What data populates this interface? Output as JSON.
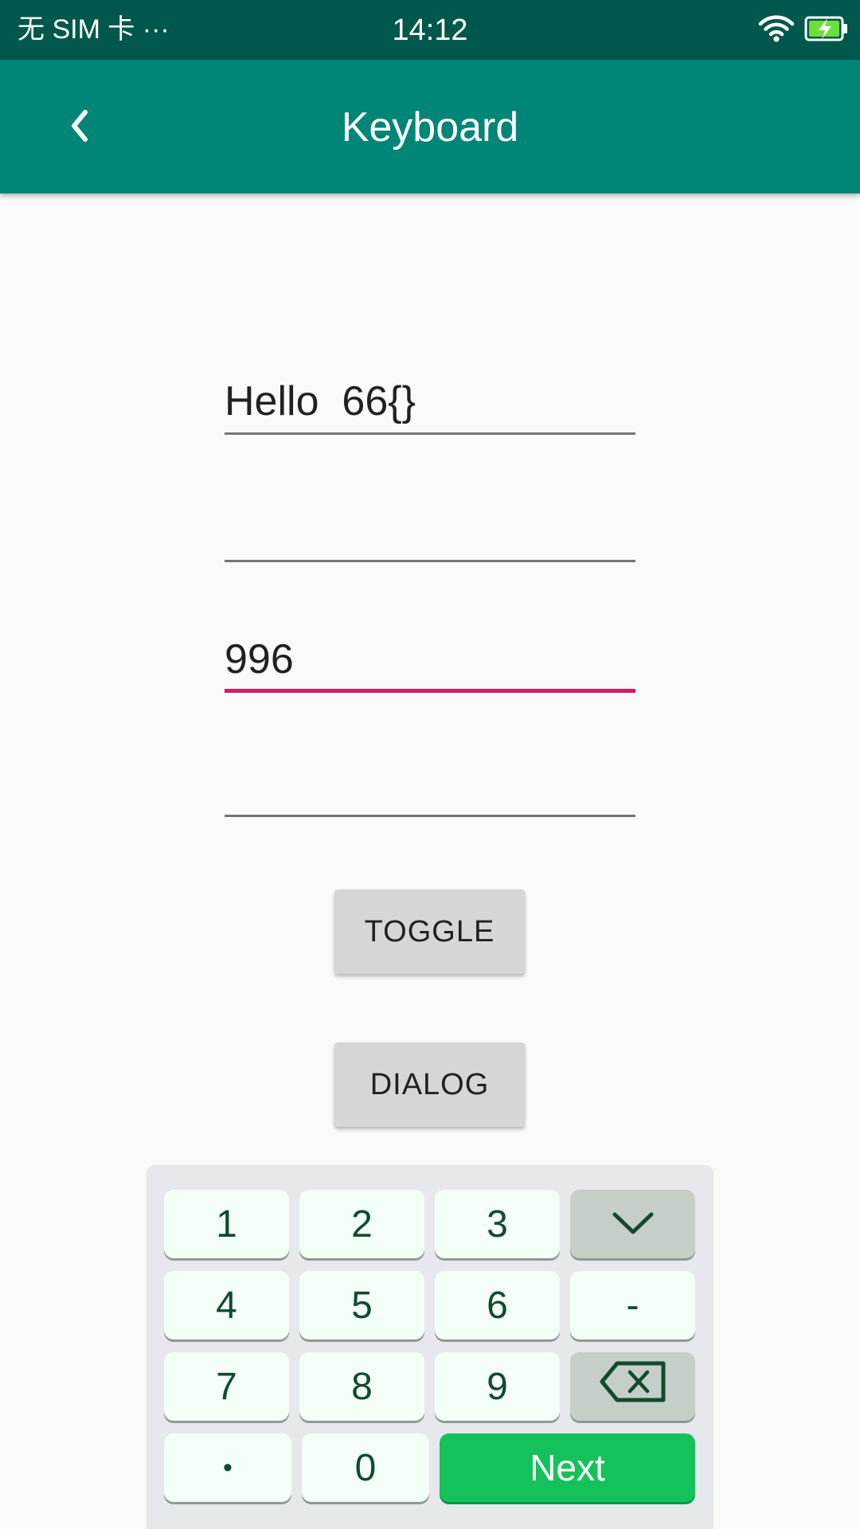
{
  "status_bar": {
    "carrier": "无 SIM 卡 ···",
    "time": "14:12",
    "wifi_icon": "wifi-icon",
    "battery_icon": "battery-charging-icon"
  },
  "app_bar": {
    "title": "Keyboard",
    "back_icon": "chevron-left-icon"
  },
  "fields": [
    {
      "value": "Hello  66{}",
      "focused": false
    },
    {
      "value": "",
      "focused": false
    },
    {
      "value": "996",
      "focused": true
    },
    {
      "value": "",
      "focused": false
    }
  ],
  "buttons": {
    "toggle_label": "TOGGLE",
    "dialog_label": "DIALOG"
  },
  "keyboard": {
    "keys": {
      "k1": "1",
      "k2": "2",
      "k3": "3",
      "k4": "4",
      "k5": "5",
      "k6": "6",
      "dash": "-",
      "k7": "7",
      "k8": "8",
      "k9": "9",
      "dot": "•",
      "k0": "0",
      "next": "Next"
    },
    "collapse_icon": "chevron-down-icon",
    "backspace_icon": "backspace-icon"
  },
  "colors": {
    "status_bar": "#00574b",
    "app_bar": "#008577",
    "focus_accent": "#d81b60",
    "next_key": "#15c15a",
    "key_text": "#124a2e"
  }
}
